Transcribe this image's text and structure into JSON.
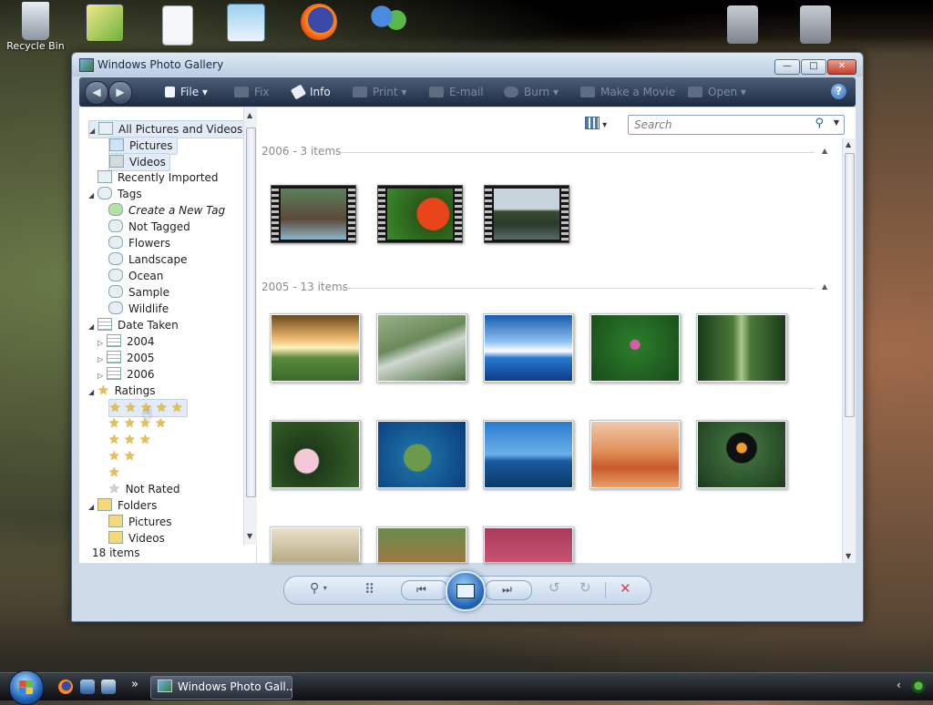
{
  "desktop": {
    "icons": [
      {
        "label": "Recycle Bin"
      },
      {
        "label": ""
      },
      {
        "label": ""
      },
      {
        "label": ""
      },
      {
        "label": ""
      },
      {
        "label": ""
      },
      {
        "label": ""
      },
      {
        "label": ""
      }
    ]
  },
  "window": {
    "title": "Windows Photo Gallery",
    "controls": {
      "minimize": "—",
      "maximize": "□",
      "close": "✕"
    }
  },
  "toolbar": {
    "back_icon": "back-arrow-icon",
    "forward_icon": "forward-arrow-icon",
    "file": "File",
    "fix": "Fix",
    "info": "Info",
    "print": "Print",
    "email": "E-mail",
    "burn": "Burn",
    "make_movie": "Make a Movie",
    "open": "Open",
    "help": "?"
  },
  "navigation": {
    "all_pictures": "All Pictures and Videos",
    "pictures": "Pictures",
    "videos": "Videos",
    "recently_imported": "Recently Imported",
    "tags": "Tags",
    "create_tag": "Create a New Tag",
    "not_tagged": "Not Tagged",
    "tag_items": [
      "Flowers",
      "Landscape",
      "Ocean",
      "Sample",
      "Wildlife"
    ],
    "date_taken": "Date Taken",
    "years": [
      "2004",
      "2005",
      "2006"
    ],
    "ratings": "Ratings",
    "rating_levels": [
      5,
      4,
      3,
      2,
      1
    ],
    "not_rated": "Not Rated",
    "folders": "Folders",
    "folder_items": [
      "Pictures",
      "Videos"
    ]
  },
  "status": {
    "count": "18 items"
  },
  "search": {
    "placeholder": "Search"
  },
  "groups": [
    {
      "label": "2006 - 3 items"
    },
    {
      "label": "2005 - 13 items"
    }
  ],
  "colors": {
    "accent": "#2d6cc0",
    "toolbar": "#1d2b40",
    "window_frame": "#cfdbe9"
  },
  "controls": {
    "zoom": "zoom-icon",
    "grid": "grid-view-icon",
    "prev": "previous-icon",
    "slideshow": "slideshow-icon",
    "next": "next-icon",
    "rotate_left": "rotate-ccw-icon",
    "rotate_right": "rotate-cw-icon",
    "delete": "delete-icon"
  },
  "taskbar": {
    "task": "Windows Photo Gall...",
    "overflow": "»"
  }
}
